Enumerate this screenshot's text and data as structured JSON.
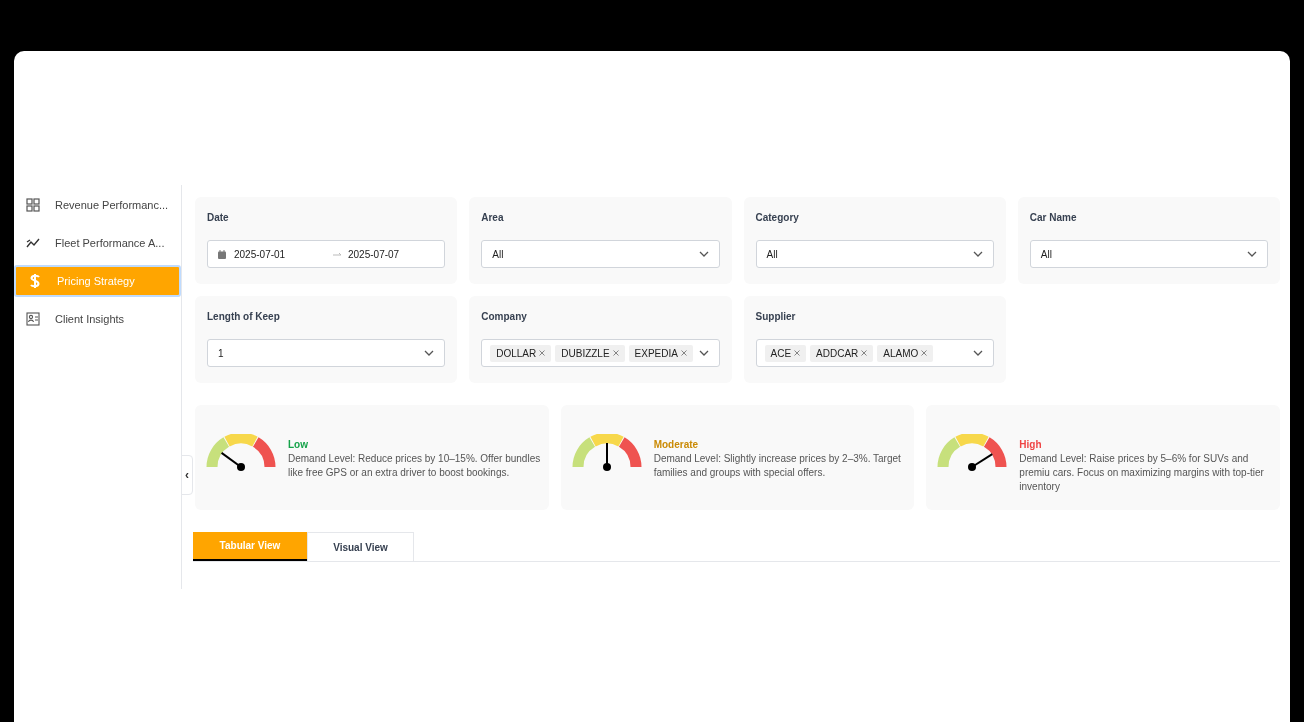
{
  "sidebar": {
    "items": [
      {
        "label": "Revenue Performanc...",
        "kind": "grid",
        "selected": false
      },
      {
        "label": "Fleet Performance A...",
        "kind": "trend",
        "selected": false
      },
      {
        "label": "Pricing Strategy",
        "kind": "dollar",
        "selected": true
      },
      {
        "label": "Client Insights",
        "kind": "profile",
        "selected": false
      }
    ],
    "collapse": "‹"
  },
  "filters": [
    {
      "label": "Date",
      "kind": "date-range",
      "start": "2025-07-01",
      "end": "2025-07-07"
    },
    {
      "label": "Area",
      "kind": "select",
      "value": "All"
    },
    {
      "label": "Category",
      "kind": "select",
      "value": "All"
    },
    {
      "label": "Car Name",
      "kind": "select",
      "value": "All"
    },
    {
      "label": "Length of Keep",
      "kind": "select",
      "value": "1"
    },
    {
      "label": "Company",
      "kind": "multi-select",
      "tags": [
        "DOLLAR",
        "DUBIZZLE",
        "EXPEDIA"
      ]
    },
    {
      "label": "Supplier",
      "kind": "multi-select",
      "tags": [
        "ACE",
        "ADDCAR",
        "ALAMO"
      ]
    }
  ],
  "demand_cards": [
    {
      "title": "Low",
      "color": "#16a34a",
      "kind": "low",
      "text": "Demand Level: Reduce prices by 10–15%. Offer bundles like free GPS or an extra driver to boost bookings."
    },
    {
      "title": "Moderate",
      "color": "#ca8a04",
      "kind": "moderate",
      "text": "Demand Level: Slightly increase prices by 2–3%. Target families and groups with special offers."
    },
    {
      "title": "High",
      "color": "#ef4444",
      "kind": "high",
      "text": "Demand Level: Raise prices by 5–6% for SUVs and premiu cars. Focus on maximizing margins with top-tier inventory"
    }
  ],
  "tabs": [
    {
      "label": "Tabular View",
      "selected": true
    },
    {
      "label": "Visual View",
      "selected": false
    }
  ]
}
